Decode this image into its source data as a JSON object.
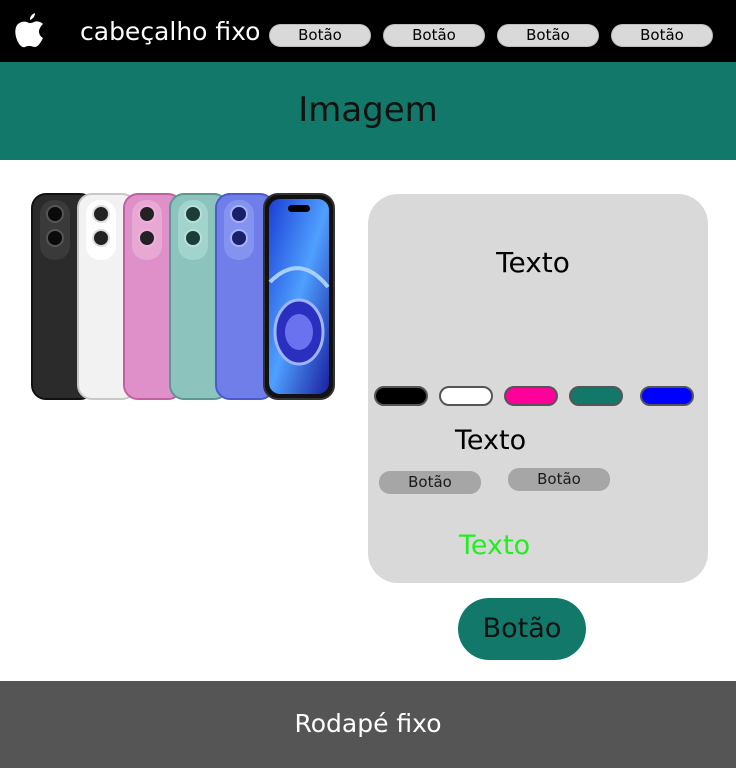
{
  "header": {
    "logo_icon": "apple-logo-icon",
    "title": "cabeçalho fixo",
    "buttons": [
      "Botão",
      "Botão",
      "Botão",
      "Botão"
    ]
  },
  "banner": {
    "title": "Imagem"
  },
  "product": {
    "image_icon": "phones-image"
  },
  "card": {
    "title": "Texto",
    "colors": [
      "#000000",
      "#ffffff",
      "#ff0099",
      "#12796a",
      "#0000ff"
    ],
    "subtitle": "Texto",
    "buttons": [
      "Botão",
      "Botão"
    ],
    "note": "Texto",
    "note_color": "#22ee22"
  },
  "main_button": {
    "label": "Botão"
  },
  "footer": {
    "text": "Rodapé fixo"
  }
}
